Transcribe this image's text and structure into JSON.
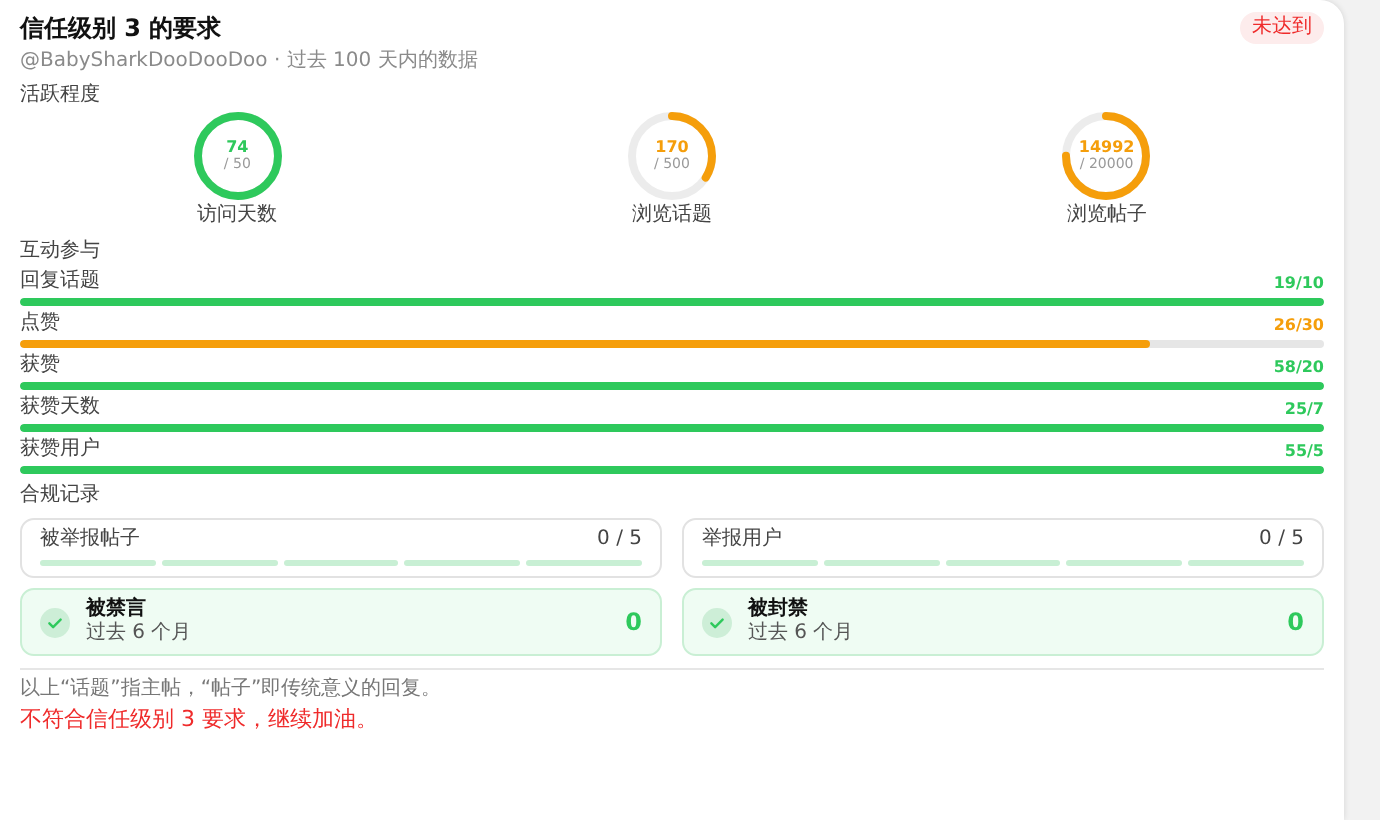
{
  "header": {
    "title": "信任级别 3 的要求",
    "status": "未达到",
    "met": false
  },
  "subtitle": "@BabySharkDooDooDoo · 过去 100 天内的数据",
  "activity": {
    "heading": "活跃程度",
    "rings": [
      {
        "value": "74",
        "target": "/ 50",
        "label": "访问天数",
        "level": 1,
        "met": true
      },
      {
        "value": "170",
        "target": "/ 500",
        "label": "浏览话题",
        "level": 0.34,
        "met": false
      },
      {
        "value": "14992",
        "target": "/ 20000",
        "label": "浏览帖子",
        "level": 0.75,
        "met": false
      }
    ]
  },
  "engagement": {
    "heading": "互动参与",
    "rows": [
      {
        "label": "回复话题",
        "reading": "19/10",
        "level": 1,
        "met": true
      },
      {
        "label": "点赞",
        "reading": "26/30",
        "level": 0.867,
        "met": false
      },
      {
        "label": "获赞",
        "reading": "58/20",
        "level": 1,
        "met": true
      },
      {
        "label": "获赞天数",
        "reading": "25/7",
        "level": 1,
        "met": true
      },
      {
        "label": "获赞用户",
        "reading": "55/5",
        "level": 1,
        "met": true
      }
    ]
  },
  "compliance": {
    "heading": "合规记录",
    "reports": [
      {
        "label": "被举报帖子",
        "reading": "0 / 5"
      },
      {
        "label": "举报用户",
        "reading": "0 / 5"
      }
    ],
    "penalties": [
      {
        "title": "被禁言",
        "period": "过去 6 个月",
        "count": "0",
        "clear": true
      },
      {
        "title": "被封禁",
        "period": "过去 6 个月",
        "count": "0",
        "clear": true
      }
    ]
  },
  "footnote": "以上“话题”指主帖，“帖子”即传统意义的回复。",
  "verdict": "不符合信任级别 3 要求，继续加油。"
}
